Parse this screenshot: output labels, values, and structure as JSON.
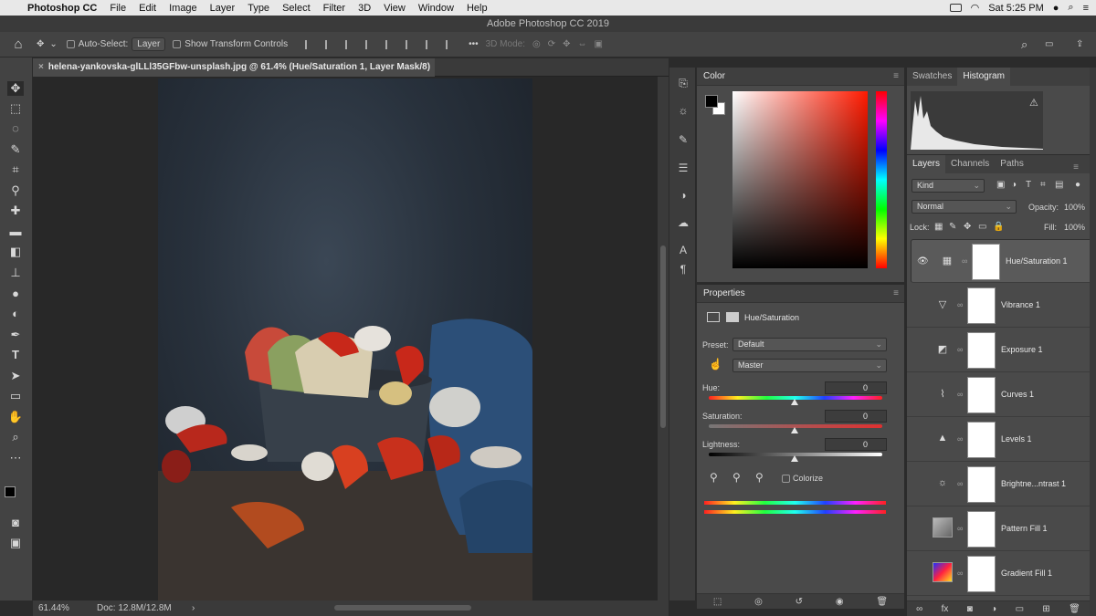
{
  "menubar": {
    "app": "Photoshop CC",
    "items": [
      "File",
      "Edit",
      "Image",
      "Layer",
      "Type",
      "Select",
      "Filter",
      "3D",
      "View",
      "Window",
      "Help"
    ],
    "clock": "Sat 5:25 PM"
  },
  "window_title": "Adobe Photoshop CC 2019",
  "options": {
    "auto_select_label": "Auto-Select:",
    "auto_select_value": "Layer",
    "show_transform_label": "Show Transform Controls",
    "mode_3d": "3D Mode:"
  },
  "document_tab": {
    "title": "helena-yankovska-glLLl35GFbw-unsplash.jpg @ 61.4% (Hue/Saturation 1, Layer Mask/8) *"
  },
  "status": {
    "zoom": "61.44%",
    "doc": "Doc: 12.8M/12.8M"
  },
  "color_panel": {
    "title": "Color",
    "foreground": "#000000",
    "background": "#ffffff",
    "hue_color": "#ff1a00"
  },
  "properties": {
    "title": "Properties",
    "adjustment": "Hue/Saturation",
    "preset_label": "Preset:",
    "preset_value": "Default",
    "channel_value": "Master",
    "hue_label": "Hue:",
    "hue_value": "0",
    "saturation_label": "Saturation:",
    "saturation_value": "0",
    "lightness_label": "Lightness:",
    "lightness_value": "0",
    "colorize_label": "Colorize"
  },
  "swatch_panel": {
    "tabs": [
      "Swatches",
      "Histogram"
    ],
    "active": "Histogram"
  },
  "layers_panel": {
    "tabs": [
      "Layers",
      "Channels",
      "Paths"
    ],
    "kind": "Kind",
    "blend_mode": "Normal",
    "opacity_label": "Opacity:",
    "opacity_value": "100%",
    "lock_label": "Lock:",
    "fill_label": "Fill:",
    "fill_value": "100%",
    "layers": [
      {
        "name": "Hue/Saturation 1",
        "icon": "hue-saturation-icon"
      },
      {
        "name": "Vibrance 1",
        "icon": "vibrance-icon"
      },
      {
        "name": "Exposure 1",
        "icon": "exposure-icon"
      },
      {
        "name": "Curves 1",
        "icon": "curves-icon"
      },
      {
        "name": "Levels 1",
        "icon": "levels-icon"
      },
      {
        "name": "Brightne...ntrast 1",
        "icon": "brightness-contrast-icon"
      },
      {
        "name": "Pattern Fill 1",
        "icon": "pattern-fill-icon"
      },
      {
        "name": "Gradient Fill 1",
        "icon": "gradient-fill-icon"
      }
    ]
  }
}
